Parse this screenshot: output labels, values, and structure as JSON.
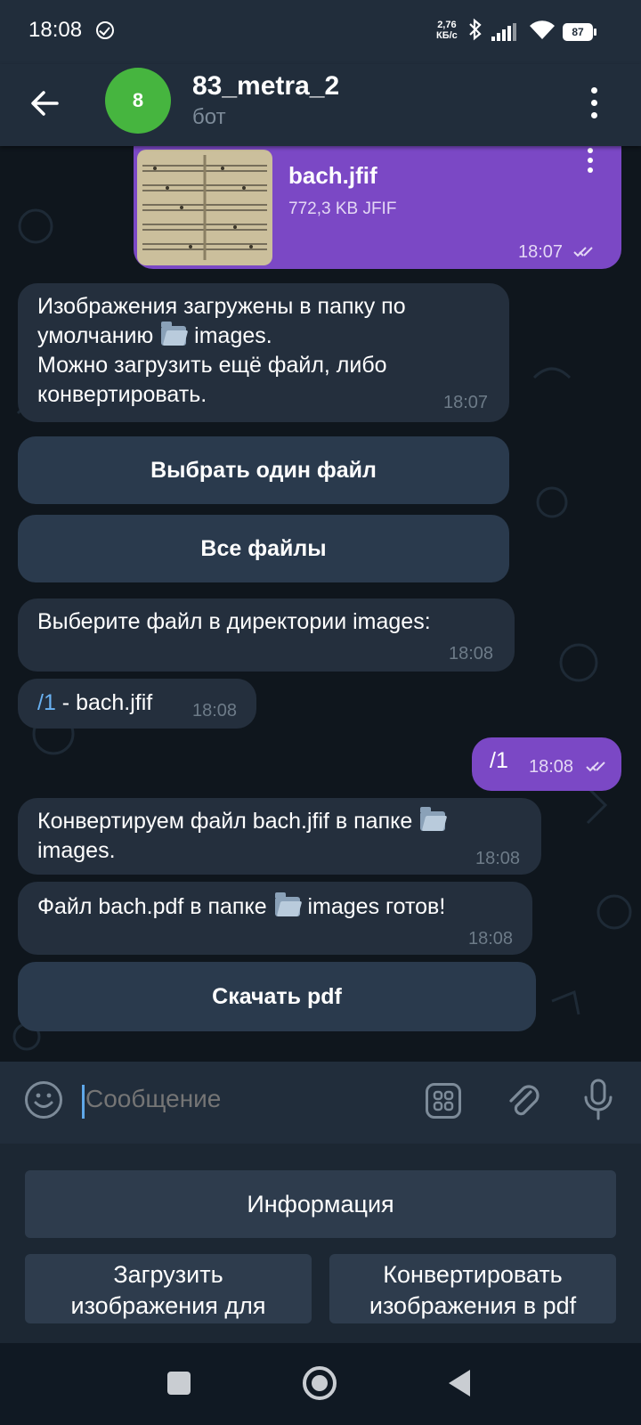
{
  "status_bar": {
    "time": "18:08",
    "net_speed_value": "2,76",
    "net_speed_unit": "КБ/с",
    "battery": "87"
  },
  "header": {
    "avatar_letter": "8",
    "title": "83_metra_2",
    "subtitle": "бот"
  },
  "messages": {
    "file": {
      "name": "bach.jfif",
      "size": "772,3 KB JFIF",
      "time": "18:07"
    },
    "m1": {
      "line1": "Изображения загружены в папку  по",
      "line2_pre": "умолчанию",
      "line2_post": "images.",
      "line3": "Можно загрузить ещё файл, либо",
      "line4": "конвертировать.",
      "time": "18:07"
    },
    "m1_buttons": [
      "Выбрать один файл",
      "Все файлы"
    ],
    "m2": {
      "text": "Выберите файл в директории images:",
      "time": "18:08"
    },
    "m3": {
      "cmd": "/1",
      "rest": " - bach.jfif",
      "time": "18:08"
    },
    "out1": {
      "text": "/1",
      "time": "18:08"
    },
    "m4": {
      "line1": "Конвертируем файл bach.jfif в папке",
      "line2": "images.",
      "time": "18:08"
    },
    "m5": {
      "pre": "Файл bach.pdf в папке",
      "post": "images готов!",
      "time": "18:08"
    },
    "m5_button": "Скачать pdf"
  },
  "input": {
    "placeholder": "Сообщение"
  },
  "reply_keyboard": {
    "info": "Информация",
    "upload_l1": "Загрузить",
    "upload_l2": "изображения для",
    "convert_l1": "Конвертировать",
    "convert_l2": "изображения в pdf"
  },
  "colors": {
    "accent": "#7b48c5",
    "incoming": "#242f3d",
    "button": "#2a3a4d",
    "link": "#6ab2f2"
  }
}
